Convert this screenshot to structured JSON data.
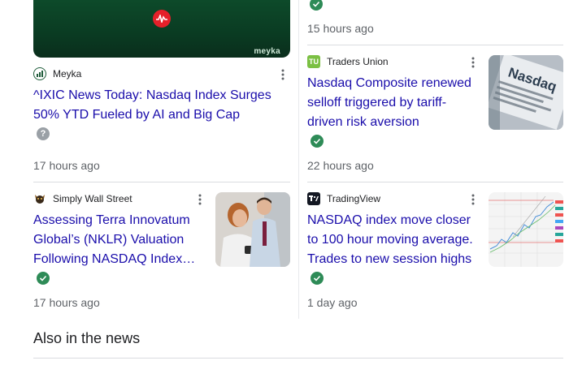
{
  "colors": {
    "link": "#1a0dab",
    "meta": "#5f6368",
    "verified": "#2e8b57",
    "divider": "#dadce0"
  },
  "hero_left": {
    "watermark": "meyka",
    "icon": "red-pulse-icon"
  },
  "top_right": {
    "verified_icon": "check-circle-icon",
    "time": "15 hours ago"
  },
  "articles": [
    {
      "source": "Meyka",
      "source_icon": "meyka-logo-icon",
      "headline_lines": [
        "^IXIC News Today: Nasdaq Index Surges",
        "50% YTD Fueled by AI and Big Cap"
      ],
      "badge": "?",
      "time": "17 hours ago"
    },
    {
      "source": "Traders Union",
      "source_icon": "traders-union-logo-icon",
      "source_logo_text": "TU",
      "headline_lines": [
        "Nasdaq Composite renewed",
        "selloff triggered by tariff-",
        "driven risk aversion"
      ],
      "verified_icon": "check-circle-icon",
      "time": "22 hours ago",
      "thumb_text": "Nasdaq"
    },
    {
      "source": "Simply Wall Street",
      "source_icon": "simply-wall-st-logo-icon",
      "headline_lines": [
        "Assessing Terra Innovatum",
        "Global’s (NKLR) Valuation",
        "Following NASDAQ Index…"
      ],
      "verified_icon": "check-circle-icon",
      "time": "17 hours ago"
    },
    {
      "source": "TradingView",
      "source_icon": "tradingview-logo-icon",
      "headline_lines": [
        "NASDAQ index move closer",
        "to 100 hour moving average.",
        "Trades to new session highs"
      ],
      "verified_icon": "check-circle-icon",
      "time": "1 day ago"
    }
  ],
  "also_in_news": "Also in the news"
}
